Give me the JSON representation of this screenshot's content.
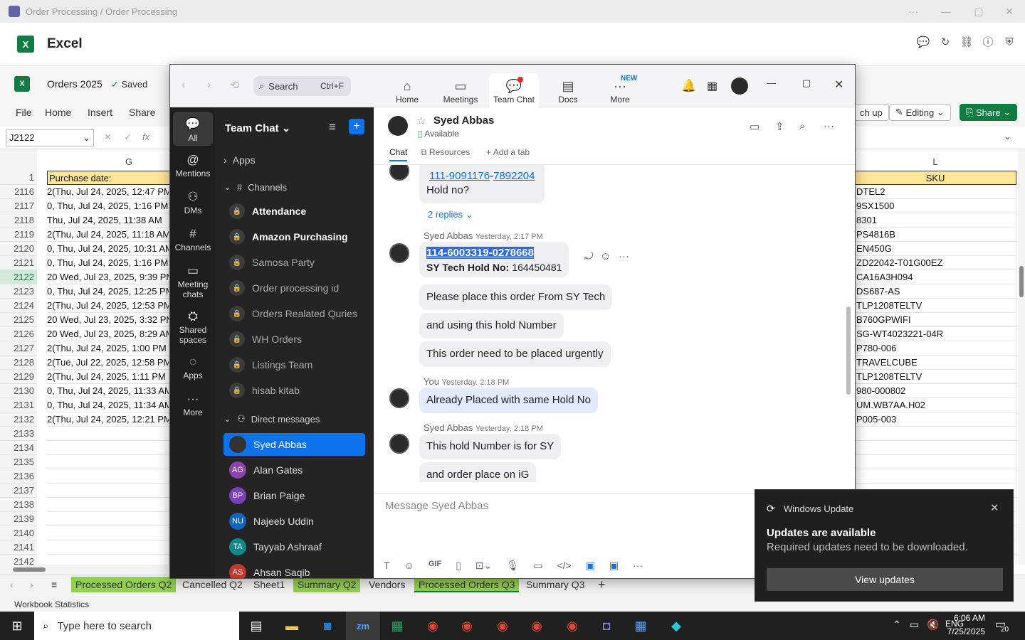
{
  "teams_title": "Order Processing / Order Processing",
  "excel": {
    "app_name": "Excel",
    "doc_name": "Orders 2025",
    "saved": "Saved",
    "menus": [
      "File",
      "Home",
      "Insert",
      "Share"
    ],
    "catchup_label": "ch up",
    "editing_label": "Editing",
    "share_label": "Share",
    "namebox": "J2122",
    "fx_label": "fx",
    "col_g": "G",
    "col_l": "L",
    "row1_num": "1",
    "row1_g": "Purchase date:",
    "row1_l": "SKU",
    "rows": [
      {
        "n": "2116",
        "g": "2(Thu, Jul 24, 2025, 12:47 PM",
        "l": "DTEL2"
      },
      {
        "n": "2117",
        "g": "0, Thu, Jul 24, 2025, 1:16 PM P",
        "l": "9SX1500"
      },
      {
        "n": "2118",
        "g": "  Thu, Jul 24, 2025, 11:38 AM",
        "l": "8301"
      },
      {
        "n": "2119",
        "g": "2(Thu, Jul 24, 2025, 11:18 AM",
        "l": "PS4816B"
      },
      {
        "n": "2120",
        "g": "0, Thu, Jul 24, 2025, 10:31 AM",
        "l": "EN450G"
      },
      {
        "n": "2121",
        "g": "0, Thu, Jul 24, 2025, 1:16 PM P",
        "l": "ZD22042-T01G00EZ"
      },
      {
        "n": "2122",
        "g": "20 Wed, Jul 23, 2025, 9:39 PM P",
        "l": "CA16A3H094"
      },
      {
        "n": "2123",
        "g": "0, Thu, Jul 24, 2025, 12:25 PM",
        "l": "DS687-AS"
      },
      {
        "n": "2124",
        "g": "2(Thu, Jul 24, 2025, 12:53 PM",
        "l": "TLP1208TELTV"
      },
      {
        "n": "2125",
        "g": "20 Wed, Jul 23, 2025, 3:32 PM P",
        "l": "B760GPWIFI"
      },
      {
        "n": "2126",
        "g": "20 Wed, Jul 23, 2025, 8:29 AM P",
        "l": "SG-WT4023221-04R"
      },
      {
        "n": "2127",
        "g": "2(Thu, Jul 24, 2025, 1:00 PM P",
        "l": "P780-006"
      },
      {
        "n": "2128",
        "g": "2(Tue, Jul 22, 2025, 12:58 PM",
        "l": "TRAVELCUBE"
      },
      {
        "n": "2129",
        "g": "2(Thu, Jul 24, 2025, 1:11 PM P",
        "l": "TLP1208TELTV"
      },
      {
        "n": "2130",
        "g": "0, Thu, Jul 24, 2025, 11:33 AM",
        "l": "980-000802"
      },
      {
        "n": "2131",
        "g": "0, Thu, Jul 24, 2025, 11:34 AM",
        "l": "UM.WB7AA.H02"
      },
      {
        "n": "2132",
        "g": "2(Thu, Jul 24, 2025, 12:21 PM",
        "l": "P005-003"
      },
      {
        "n": "2133",
        "g": "",
        "l": ""
      },
      {
        "n": "2134",
        "g": "",
        "l": ""
      },
      {
        "n": "2135",
        "g": "",
        "l": ""
      },
      {
        "n": "2136",
        "g": "",
        "l": ""
      },
      {
        "n": "2137",
        "g": "",
        "l": ""
      },
      {
        "n": "2138",
        "g": "",
        "l": ""
      },
      {
        "n": "2139",
        "g": "",
        "l": ""
      },
      {
        "n": "2140",
        "g": "",
        "l": ""
      },
      {
        "n": "2141",
        "g": "",
        "l": ""
      },
      {
        "n": "2142",
        "g": "",
        "l": ""
      }
    ],
    "sheets": [
      {
        "label": "Processed Orders Q2",
        "green": true
      },
      {
        "label": "Cancelled Q2",
        "green": false
      },
      {
        "label": "Sheet1",
        "green": false
      },
      {
        "label": "Summary Q2",
        "green": true
      },
      {
        "label": "Vendors",
        "green": false
      },
      {
        "label": "Processed Orders Q3",
        "green": true
      },
      {
        "label": "Summary Q3",
        "green": false
      }
    ],
    "status": "Workbook Statistics"
  },
  "zoom": {
    "search_label": "Search",
    "search_shortcut": "Ctrl+F",
    "nav": [
      "Home",
      "Meetings",
      "Team Chat",
      "Docs",
      "More"
    ],
    "new_badge": "NEW",
    "rail": [
      "All",
      "Mentions",
      "DMs",
      "Channels",
      "Meeting chats",
      "Shared spaces",
      "Apps",
      "More"
    ],
    "list_title": "Team Chat",
    "apps_label": "Apps",
    "channels_label": "Channels",
    "channels": [
      "Attendance",
      "Amazon Purchasing",
      "Samosa Party",
      "Order processing id",
      "Orders Realated Quries",
      "WH Orders",
      "Listings Team",
      "hisab kitab"
    ],
    "dm_label": "Direct messages",
    "dms": [
      {
        "name": "Syed Abbas",
        "initials": "",
        "color": "#333"
      },
      {
        "name": "Alan Gates",
        "initials": "AG",
        "color": "#8e44ad"
      },
      {
        "name": "Brian Paige",
        "initials": "BP",
        "color": "#7b3fb8"
      },
      {
        "name": "Najeeb Uddin",
        "initials": "NU",
        "color": "#1565c0"
      },
      {
        "name": "Tayyab Ashraaf",
        "initials": "TA",
        "color": "#0e8a8a"
      },
      {
        "name": "Ahsan Saqib",
        "initials": "AS",
        "color": "#c0392b"
      }
    ],
    "contact_name": "Syed Abbas",
    "contact_status": "Available",
    "tabs": [
      "Chat",
      "Resources",
      "Add a tab"
    ],
    "msg_link1": "111-9091176",
    "msg_link1b": "7892204",
    "msg_holdno": "Hold no?",
    "replies": "2 replies",
    "m1_author": "Syed Abbas",
    "m1_time": "Yesterday, 2:17 PM",
    "m1_link": "114-6003319-0278668",
    "m1_line2a": "SY Tech  Hold No:",
    "m1_line2b": "164450481",
    "m1_b2": "Please place this order From SY Tech",
    "m1_b3": "and using this hold Number",
    "m1_b4": "This order need to be placed urgently",
    "m2_author": "You",
    "m2_time": "Yesterday, 2:18 PM",
    "m2_b1": "Already Placed with same Hold No",
    "m3_author": "Syed Abbas",
    "m3_time": "Yesterday, 2:18 PM",
    "m3_b1": "This hold Number is for SY",
    "m3_b2": "and order place on iG",
    "compose_placeholder": "Message Syed Abbas"
  },
  "notification": {
    "app": "Windows Update",
    "title": "Updates are available",
    "body": "Required updates need to be downloaded.",
    "button": "View updates"
  },
  "taskbar": {
    "search_placeholder": "Type here to search",
    "time": "6:06 AM",
    "date": "7/25/2025",
    "notif_count": "20",
    "zoom_label": "zm"
  }
}
